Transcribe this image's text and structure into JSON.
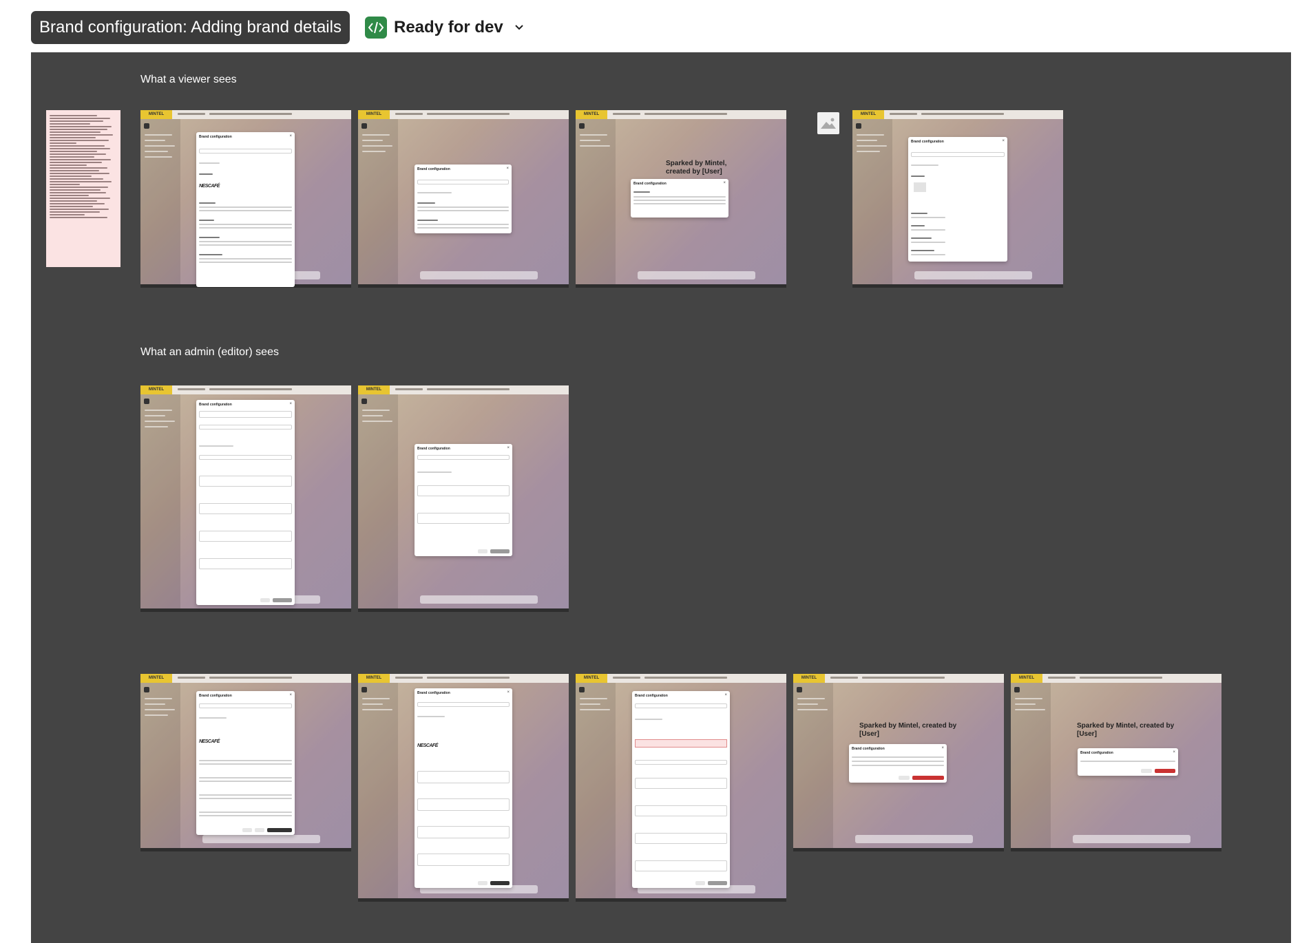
{
  "header": {
    "title": "Brand configuration: Adding brand details",
    "status_label": "Ready for dev",
    "status_color": "#2f8a47",
    "status_icon": "code-icon",
    "dropdown_icon": "chevron-down-icon"
  },
  "sections": {
    "viewer_label": "What a viewer sees",
    "admin_label": "What an admin (editor) sees"
  },
  "mockup": {
    "logo_text": "MINTEL",
    "modal_title": "Brand configuration",
    "spark_text": "Sparked by Mintel, created by [User]",
    "brand_logo_text": "NESCAFÉ"
  }
}
